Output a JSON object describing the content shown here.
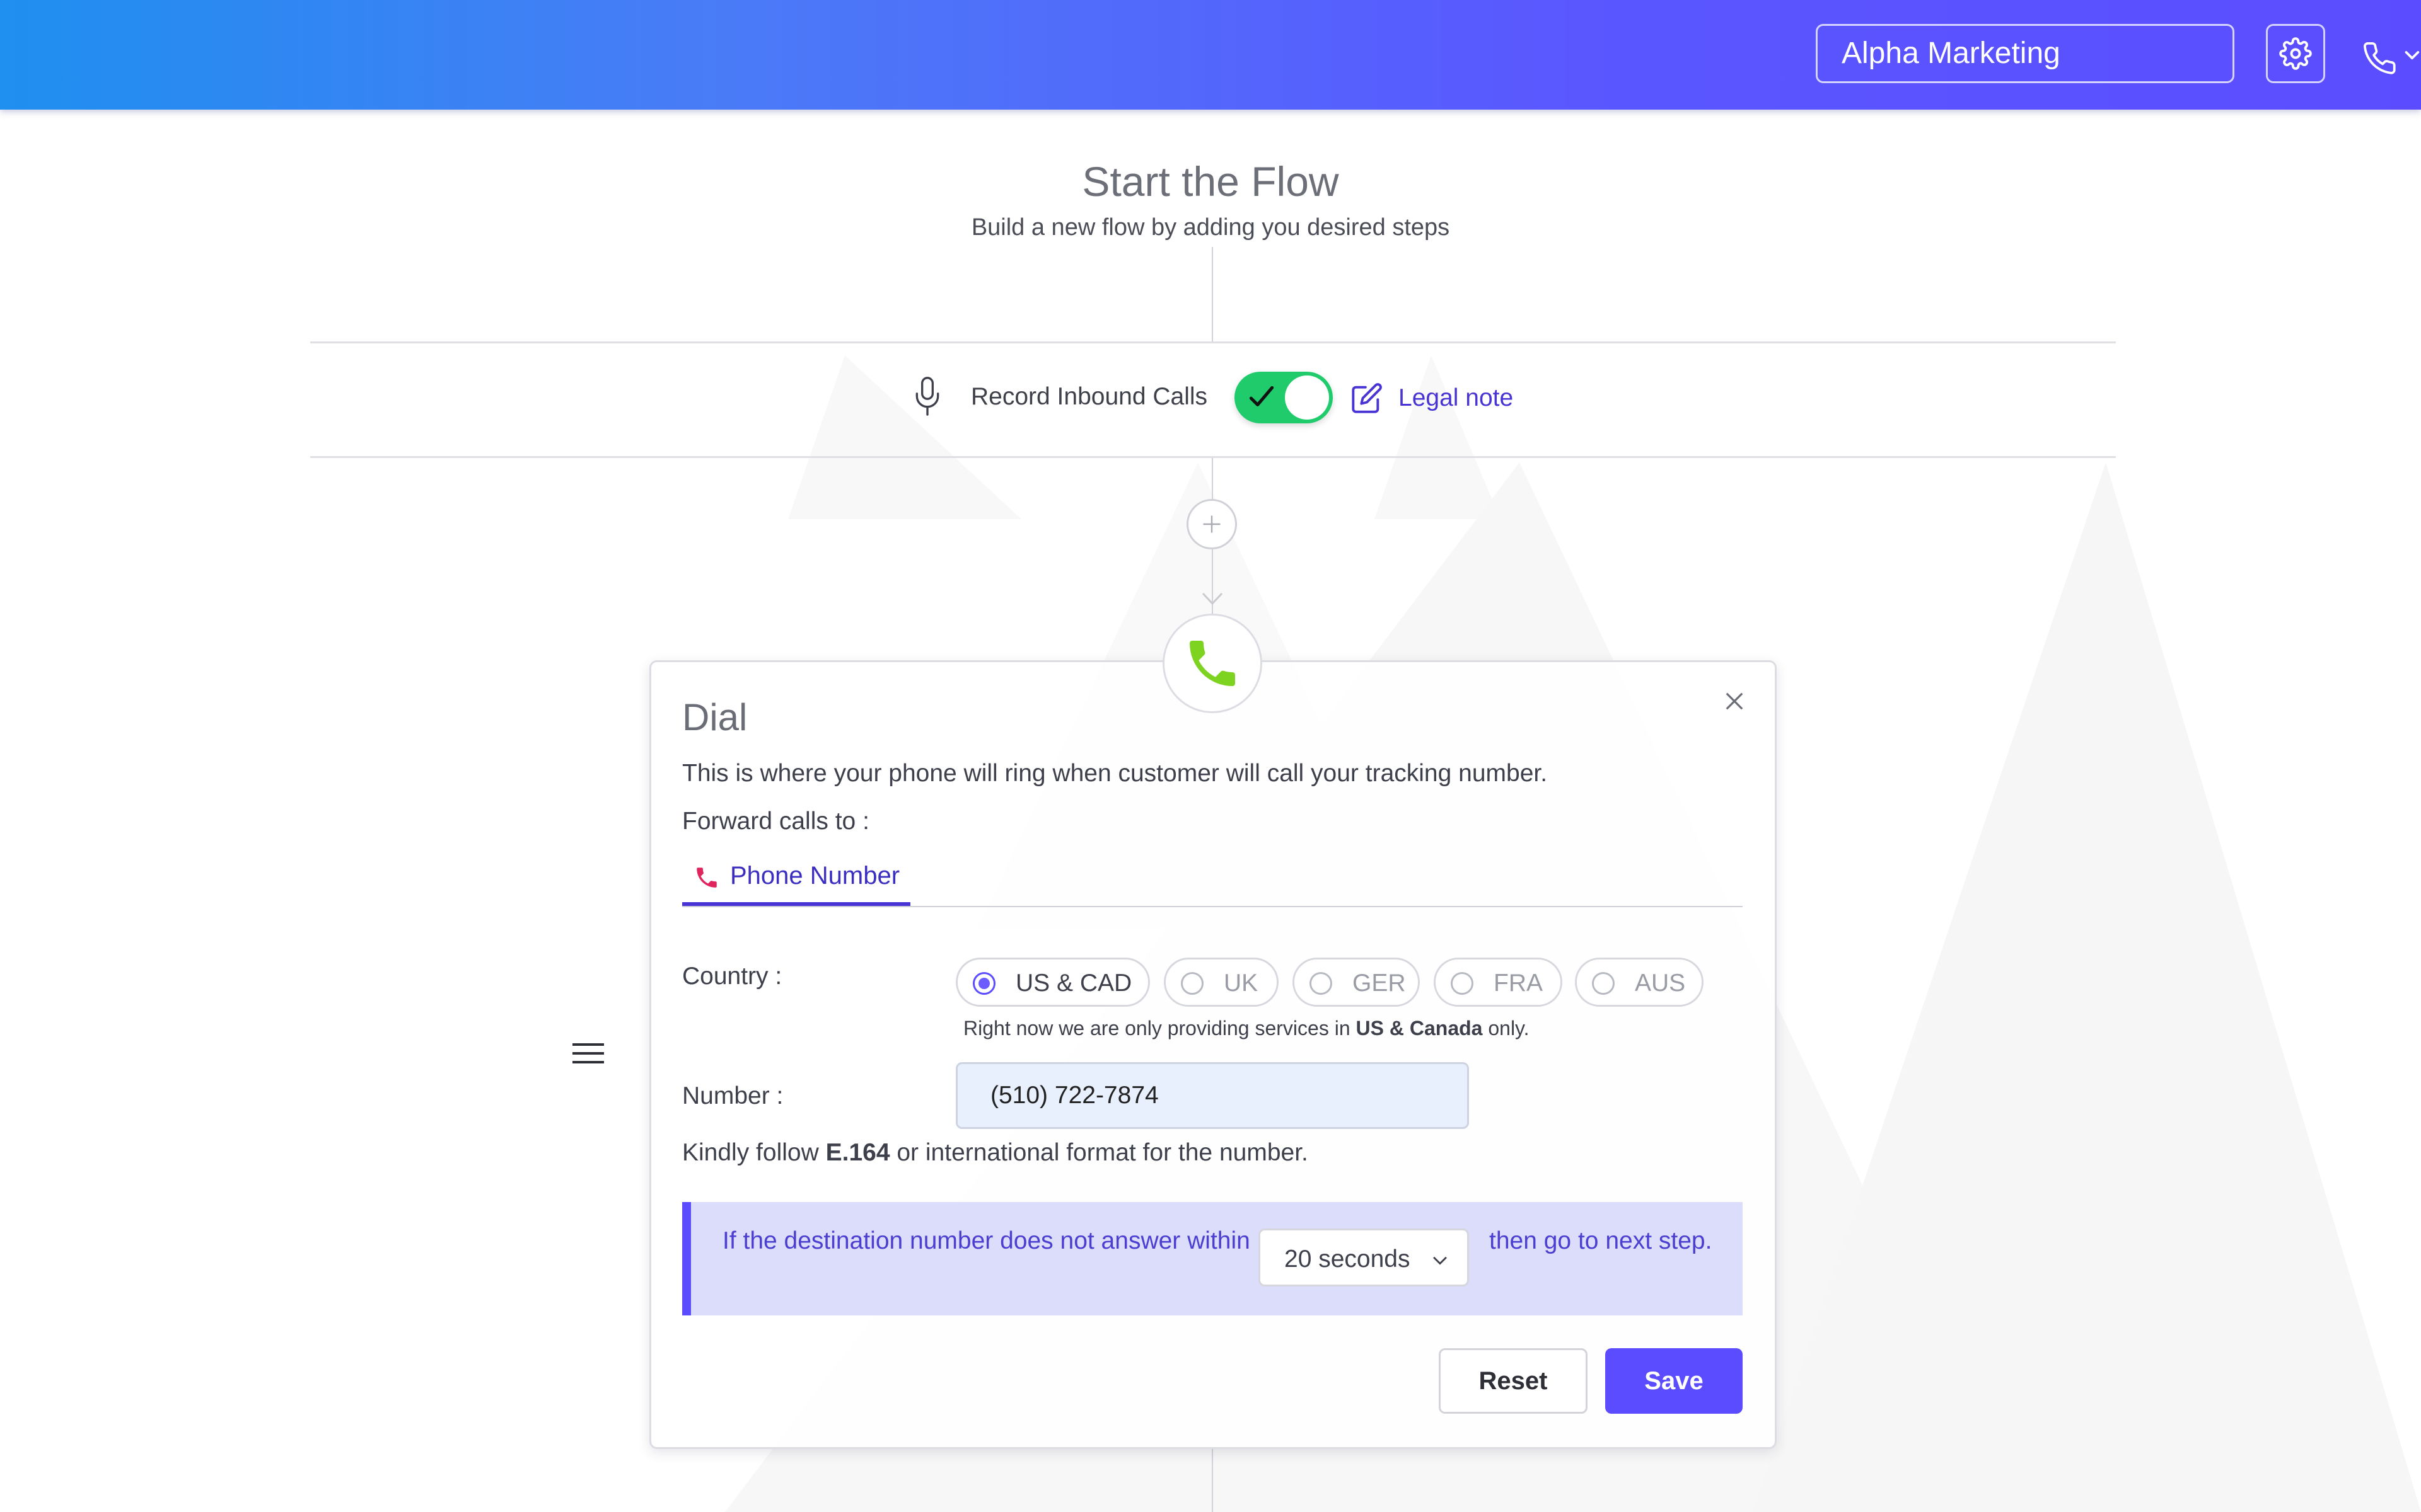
{
  "header": {
    "organization": "Alpha Marketing",
    "settings_icon": "gear-icon",
    "phone_icon": "phone-icon"
  },
  "flow": {
    "title": "Start the Flow",
    "subtitle": "Build a new flow by adding you desired steps"
  },
  "record": {
    "label": "Record Inbound Calls",
    "enabled": true,
    "legal_note": "Legal note"
  },
  "dial": {
    "title": "Dial",
    "description": "This is where your phone will ring when customer will call your tracking number.",
    "forward_label": "Forward calls to :",
    "tab_label": "Phone Number",
    "country_label": "Country :",
    "countries": [
      "US & CAD",
      "UK",
      "GER",
      "FRA",
      "AUS"
    ],
    "selected_country": "US & CAD",
    "country_note_pre": "Right now we are only providing services in ",
    "country_note_bold": "US & Canada",
    "country_note_post": " only.",
    "number_label": "Number :",
    "number_value": "(510) 722-7874",
    "format_note_pre": "Kindly follow ",
    "format_note_bold": "E.164",
    "format_note_post": " or international format for the number.",
    "timeout_pre": "If the destination number does not answer within",
    "timeout_value": "20 seconds",
    "timeout_post": "then go to next step.",
    "reset_label": "Reset",
    "save_label": "Save"
  },
  "colors": {
    "accent": "#5b4dff",
    "toggle_on": "#1fcb6b",
    "dial_icon": "#7ed321",
    "tab_phone_icon": "#e0245e"
  }
}
